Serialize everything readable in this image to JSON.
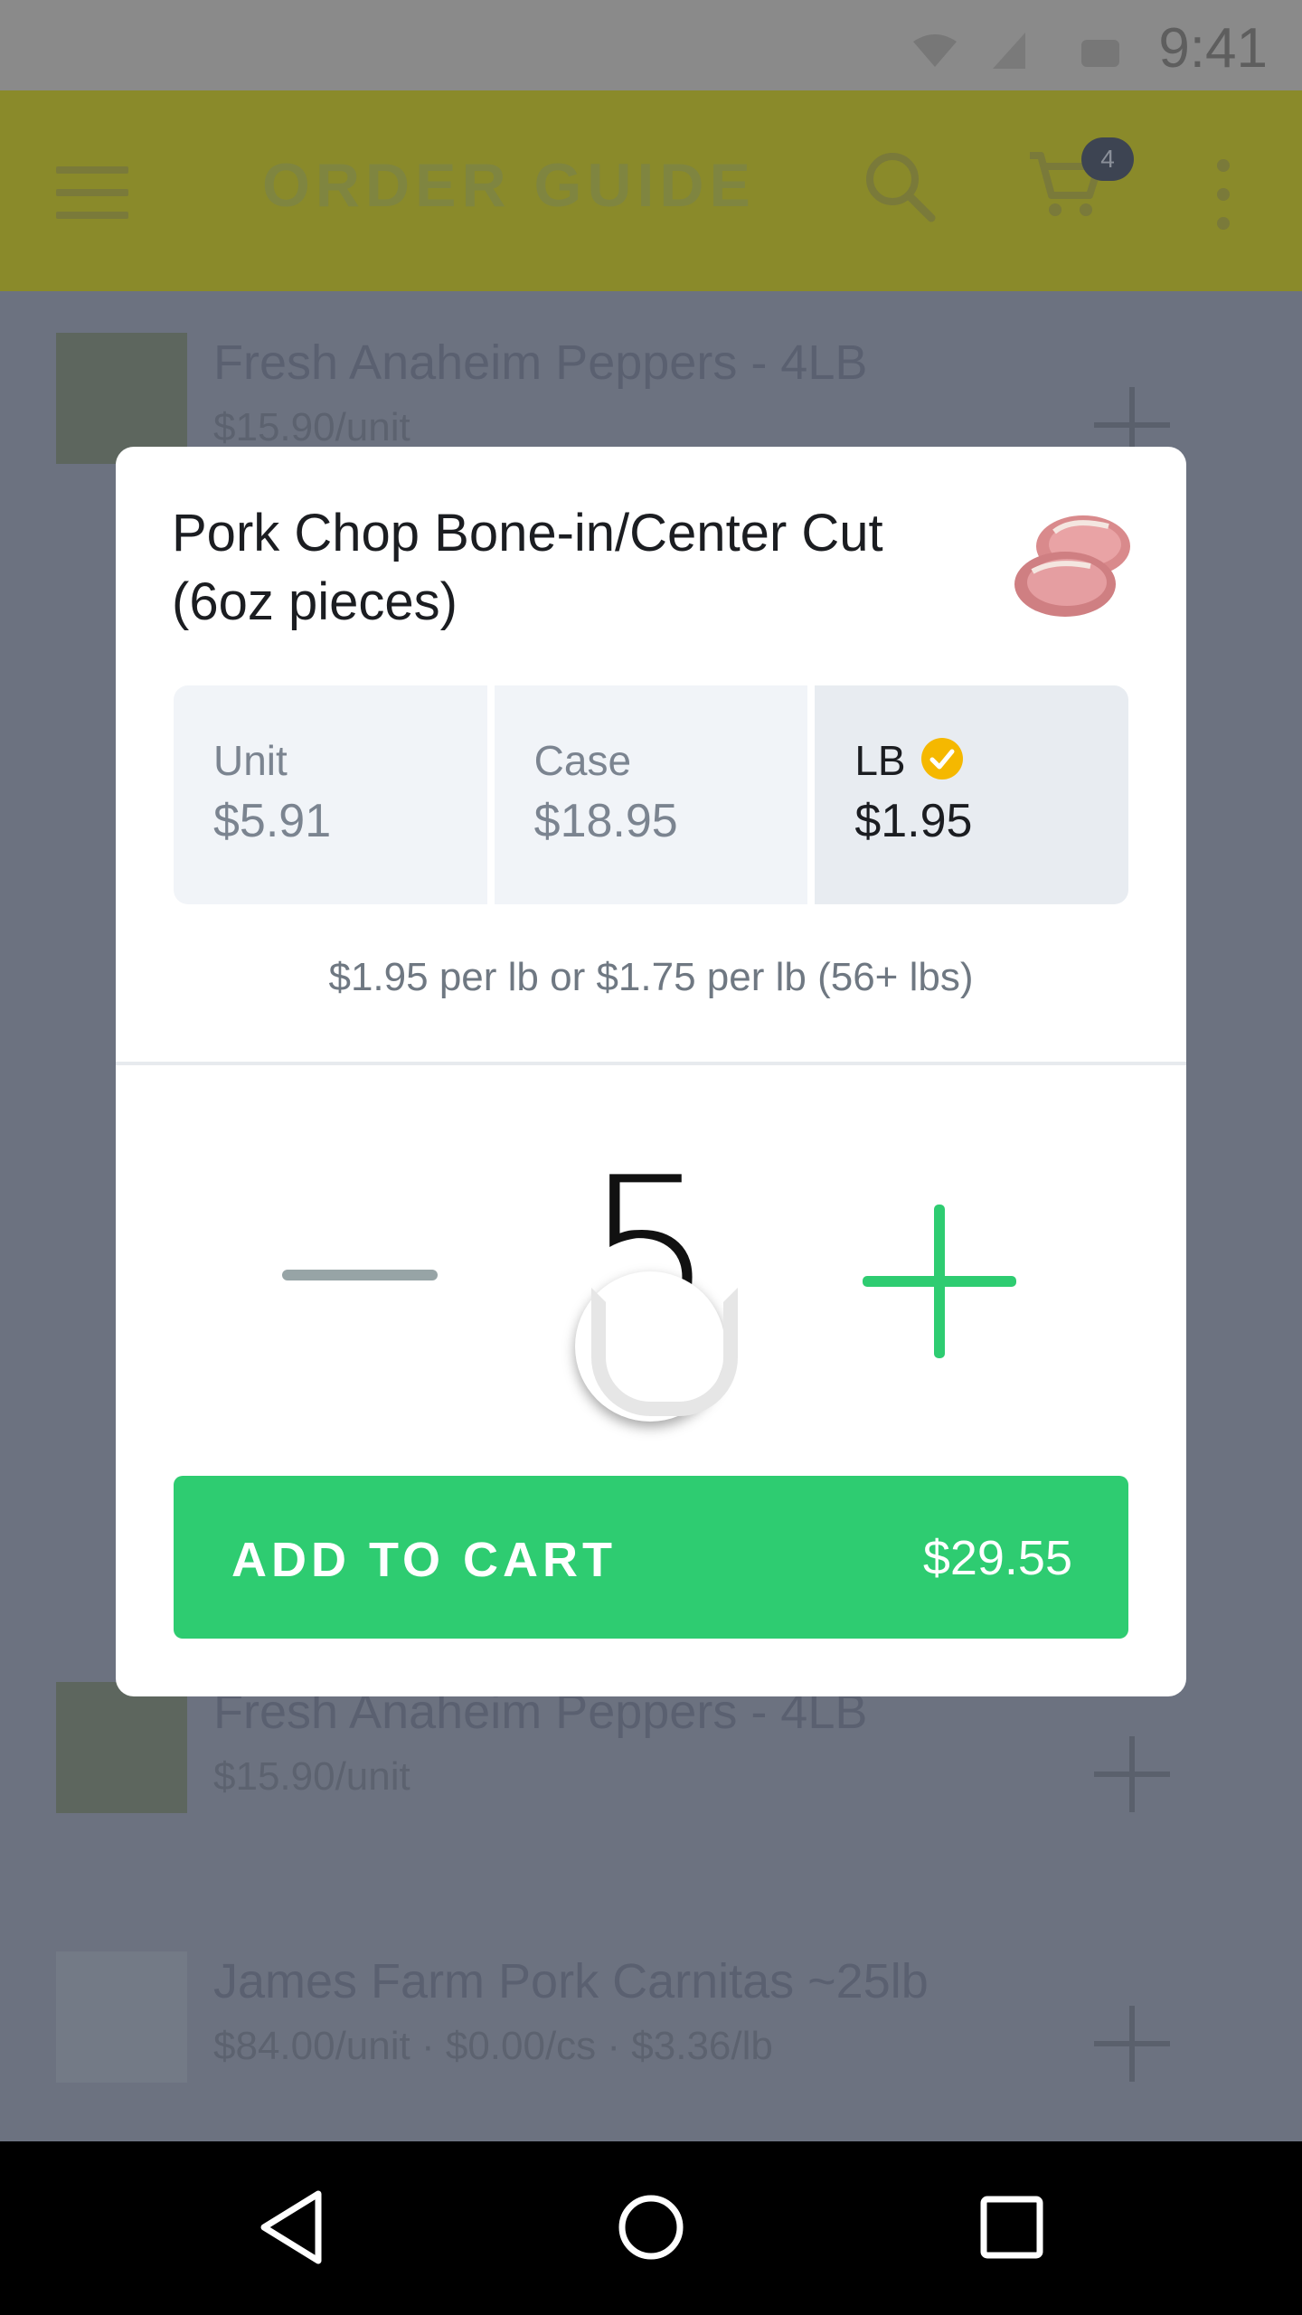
{
  "status_bar": {
    "time": "9:41"
  },
  "app_bar": {
    "title": "ORDER GUIDE",
    "cart_count": "4"
  },
  "list_items": [
    {
      "name": "Fresh Anaheim Peppers - 4LB",
      "price": "$15.90/unit"
    },
    {
      "name": "Fresh Anaheim Peppers - 4LB",
      "price": "$15.90/unit"
    },
    {
      "name": "James Farm Pork Carnitas ~25lb",
      "price": "$84.00/unit · $0.00/cs · $3.36/lb"
    }
  ],
  "dialog": {
    "product_title": "Pork Chop Bone-in/Center Cut (6oz pieces)",
    "price_options": [
      {
        "label": "Unit",
        "price": "$5.91",
        "selected": false
      },
      {
        "label": "Case",
        "price": "$18.95",
        "selected": false
      },
      {
        "label": "LB",
        "price": "$1.95",
        "selected": true
      }
    ],
    "price_note": "$1.95 per lb or $1.75 per lb (56+ lbs)",
    "quantity": "5",
    "add_to_cart_label": "ADD TO CART",
    "total": "$29.55"
  },
  "colors": {
    "accent_green": "#2ecc71",
    "check_yellow": "#f5b800",
    "scrim": "#6c7280"
  },
  "icons": [
    "menu-icon",
    "search-icon",
    "cart-icon",
    "overflow-icon",
    "check-icon",
    "minus-icon",
    "plus-icon",
    "back-icon",
    "home-icon",
    "recents-icon"
  ]
}
